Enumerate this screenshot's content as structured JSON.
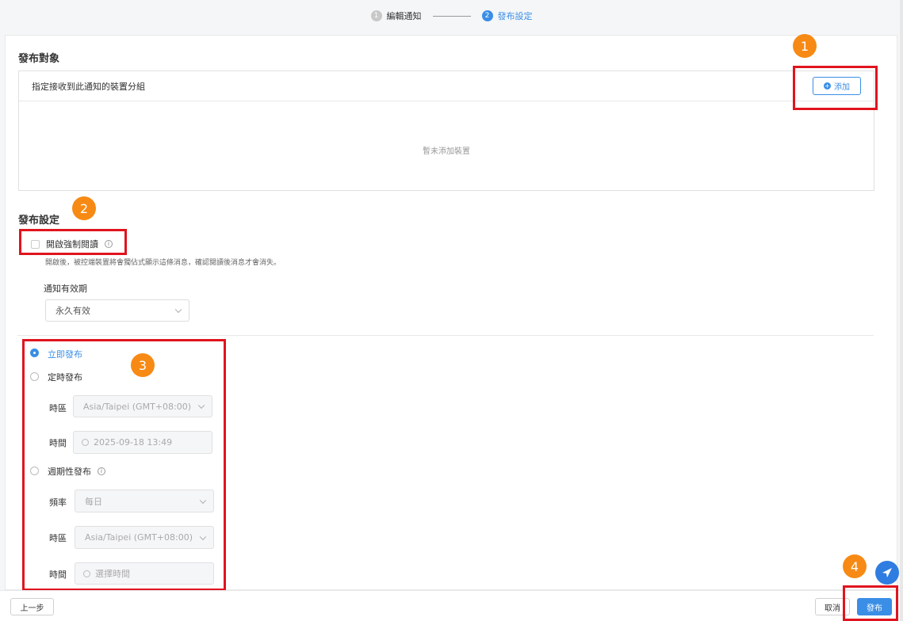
{
  "steps": [
    {
      "num": "1",
      "label": "編輯通知",
      "active": false
    },
    {
      "num": "2",
      "label": "發布設定",
      "active": true
    }
  ],
  "target": {
    "title": "發布對象",
    "panel_header": "指定接收到此通知的裝置分組",
    "add_label": "添加",
    "empty_text": "暫未添加裝置"
  },
  "settings": {
    "title": "發布設定",
    "force_read_label": "開啟強制閱讀",
    "force_read_desc": "開啟後，被控端裝置將會獨佔式顯示這條消息，確認閱讀後消息才會消失。",
    "validity_label": "通知有效期",
    "validity_value": "永久有效"
  },
  "publish": {
    "immediate_label": "立即發布",
    "scheduled_label": "定時發布",
    "timezone_label": "時區",
    "timezone_value": "Asia/Taipei (GMT+08:00)",
    "time_label": "時間",
    "time_value": "2025-09-18 13:49",
    "periodic_label": "週期性發布",
    "frequency_label": "頻率",
    "frequency_value": "每日",
    "periodic_timezone_value": "Asia/Taipei (GMT+08:00)",
    "periodic_time_placeholder": "選擇時間"
  },
  "badges": [
    "1",
    "2",
    "3",
    "4"
  ],
  "footer": {
    "prev_label": "上一步",
    "cancel_label": "取消",
    "publish_label": "發布"
  },
  "colors": {
    "accent": "#3a8ee6",
    "highlight": "#e0141e",
    "badge": "#f78a14"
  }
}
